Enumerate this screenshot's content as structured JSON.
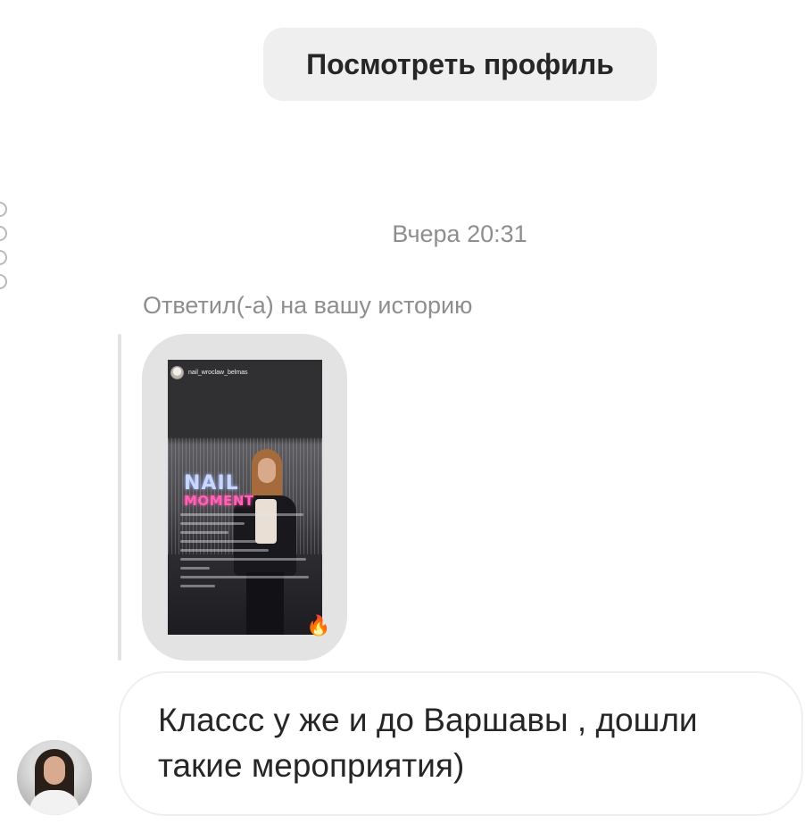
{
  "header": {
    "view_profile_label": "Посмотреть профиль"
  },
  "thread": {
    "timestamp": "Вчера 20:31",
    "reply_caption": "Ответил(-а) на вашу историю",
    "story": {
      "username": "nail_wroclaw_belmas",
      "title_line1": "NAIL",
      "title_line2": "MOMENT",
      "reaction": "🔥"
    },
    "message": {
      "text": "Класcс у же и до Варшавы , дошли такие мероприятия)"
    }
  }
}
